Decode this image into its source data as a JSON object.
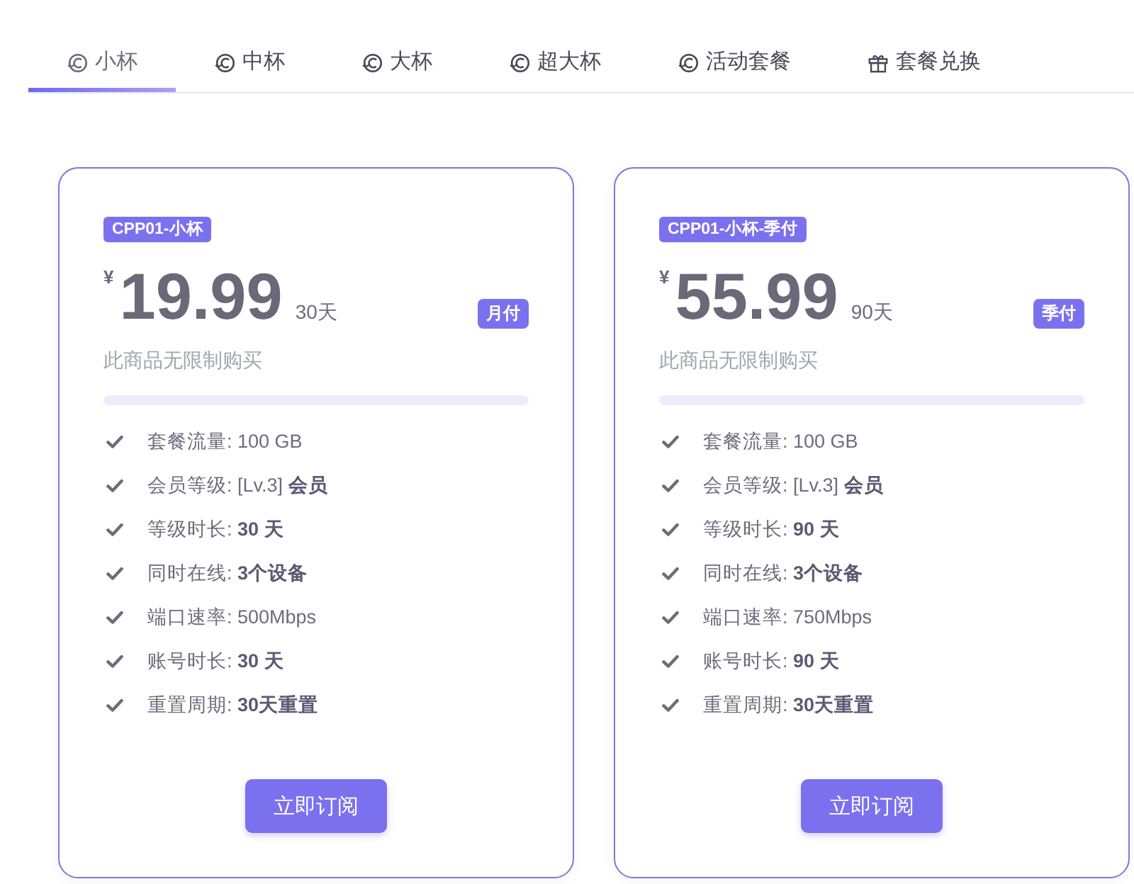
{
  "tabs": [
    {
      "label": "小杯",
      "kind": "swirl",
      "selected": true
    },
    {
      "label": "中杯",
      "kind": "swirl",
      "selected": false
    },
    {
      "label": "大杯",
      "kind": "swirl",
      "selected": false
    },
    {
      "label": "超大杯",
      "kind": "swirl",
      "selected": false
    },
    {
      "label": "活动套餐",
      "kind": "swirl",
      "selected": false
    },
    {
      "label": "套餐兑换",
      "kind": "gift",
      "selected": false
    }
  ],
  "plans": [
    {
      "code": "CPP01-小杯",
      "currency": "¥",
      "price": "19.99",
      "period": "30天",
      "billing": "月付",
      "note": "此商品无限制购买",
      "features": [
        "套餐流量: 100 GB",
        "会员等级: [Lv.3] **会员**",
        "等级时长: **30 天**",
        "同时在线: **3个设备**",
        "端口速率: 500Mbps",
        "账号时长: **30 天**",
        "重置周期: **30天重置**"
      ],
      "button": "立即订阅"
    },
    {
      "code": "CPP01-小杯-季付",
      "currency": "¥",
      "price": "55.99",
      "period": "90天",
      "billing": "季付",
      "note": "此商品无限制购买",
      "features": [
        "套餐流量: 100 GB",
        "会员等级: [Lv.3] **会员**",
        "等级时长: **90 天**",
        "同时在线: **3个设备**",
        "端口速率: 750Mbps",
        "账号时长: **90 天**",
        "重置周期: **30天重置**"
      ],
      "button": "立即订阅"
    }
  ]
}
